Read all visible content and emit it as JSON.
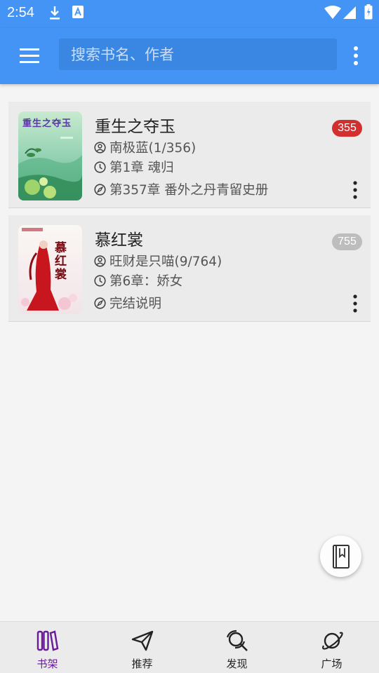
{
  "status_bar": {
    "time": "2:54"
  },
  "search": {
    "placeholder": "搜索书名、作者"
  },
  "books": [
    {
      "title": "重生之夺玉",
      "cover_title": "重生之夺玉",
      "author_progress": "南极蓝(1/356)",
      "last_read": "第1章 魂归",
      "latest_chapter": "第357章 番外之丹青留史册",
      "unread_count": "355",
      "badge_color": "#d32f2f"
    },
    {
      "title": "慕红裳",
      "cover_title": "慕红裳",
      "author_progress": "旺财是只喵(9/764)",
      "last_read": "第6章：娇女",
      "latest_chapter": "完结说明",
      "unread_count": "755",
      "badge_color": "#bdbdbd"
    }
  ],
  "bottom_nav": {
    "items": [
      {
        "label": "书架",
        "icon": "bookshelf-icon",
        "active": true
      },
      {
        "label": "推荐",
        "icon": "paper-plane-icon",
        "active": false
      },
      {
        "label": "发现",
        "icon": "discover-icon",
        "active": false
      },
      {
        "label": "广场",
        "icon": "planet-icon",
        "active": false
      }
    ]
  },
  "colors": {
    "primary": "#4394f4",
    "search_bg": "#3a86e3",
    "active_nav": "#6a1b9a",
    "badge_red": "#d32f2f",
    "badge_gray": "#bdbdbd"
  }
}
